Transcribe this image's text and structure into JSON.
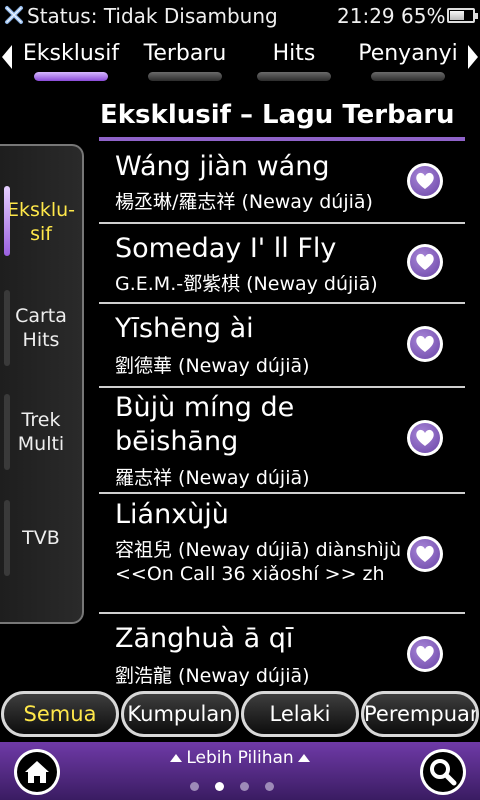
{
  "status": {
    "icon": "disconnected-x-icon",
    "text": "Status: Tidak Disambung",
    "time": "21:29",
    "battery": "65%",
    "battery_level": 0.65
  },
  "tabs": [
    {
      "label": "Eksklusif",
      "active": true
    },
    {
      "label": "Terbaru",
      "active": false
    },
    {
      "label": "Hits",
      "active": false
    },
    {
      "label": "Penyanyi",
      "active": false
    }
  ],
  "section_title": "Eksklusif – Lagu Terbaru",
  "sidemenu": [
    {
      "label": "Eksklu-\nsif",
      "active": true
    },
    {
      "label": "Carta\nHits",
      "active": false
    },
    {
      "label": "Trek\nMulti",
      "active": false
    },
    {
      "label": "TVB",
      "active": false
    }
  ],
  "songs": [
    {
      "title": "Wáng jiàn wáng",
      "sub": "楊丞琳/羅志祥 (Neway dújiā)"
    },
    {
      "title": "Someday I' ll Fly",
      "sub": "G.E.M.-鄧紫棋 (Neway dújiā)"
    },
    {
      "title": "Yīshēng ài",
      "sub": "劉德華 (Neway dújiā)"
    },
    {
      "title": "Bùjù míng de bēishāng",
      "sub": "羅志祥 (Neway dújiā)"
    },
    {
      "title": "Liánxùjù",
      "sub": "容祖兒 (Neway dújiā) diànshìjù <<On Call 36 xiǎoshí >> zh"
    },
    {
      "title": "Zānghuà ā qī",
      "sub": "劉浩龍 (Neway dújiā)"
    }
  ],
  "filters": [
    {
      "label": "Semua",
      "active": true
    },
    {
      "label": "Kumpulan",
      "active": false
    },
    {
      "label": "Lelaki",
      "active": false
    },
    {
      "label": "Perempuan",
      "active": false
    }
  ],
  "bottom": {
    "more_label": "Lebih Pilihan",
    "home_icon": "home-icon",
    "search_icon": "search-icon",
    "page_count": 4,
    "current_page": 2
  },
  "colors": {
    "accent": "#8f63c9",
    "active_text": "#ffe84a",
    "bottom_bar": "#5a2d8f"
  }
}
